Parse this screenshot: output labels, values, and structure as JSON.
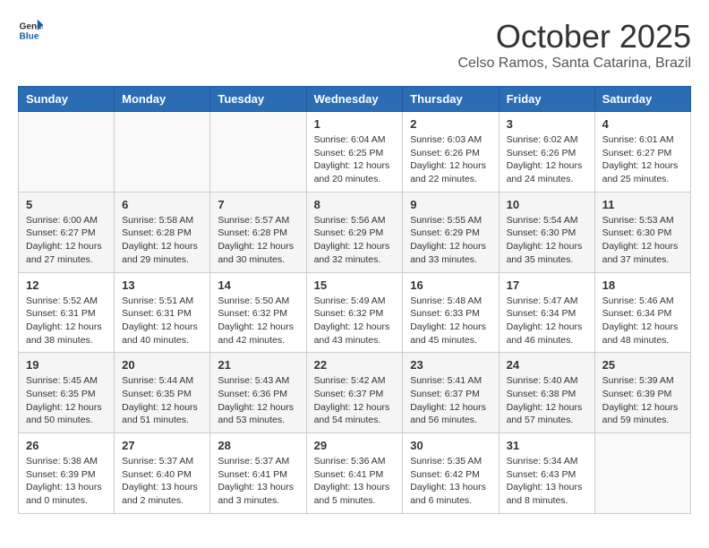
{
  "header": {
    "logo_general": "General",
    "logo_blue": "Blue",
    "month_title": "October 2025",
    "subtitle": "Celso Ramos, Santa Catarina, Brazil"
  },
  "weekdays": [
    "Sunday",
    "Monday",
    "Tuesday",
    "Wednesday",
    "Thursday",
    "Friday",
    "Saturday"
  ],
  "weeks": [
    [
      {
        "day": "",
        "info": ""
      },
      {
        "day": "",
        "info": ""
      },
      {
        "day": "",
        "info": ""
      },
      {
        "day": "1",
        "info": "Sunrise: 6:04 AM\nSunset: 6:25 PM\nDaylight: 12 hours\nand 20 minutes."
      },
      {
        "day": "2",
        "info": "Sunrise: 6:03 AM\nSunset: 6:26 PM\nDaylight: 12 hours\nand 22 minutes."
      },
      {
        "day": "3",
        "info": "Sunrise: 6:02 AM\nSunset: 6:26 PM\nDaylight: 12 hours\nand 24 minutes."
      },
      {
        "day": "4",
        "info": "Sunrise: 6:01 AM\nSunset: 6:27 PM\nDaylight: 12 hours\nand 25 minutes."
      }
    ],
    [
      {
        "day": "5",
        "info": "Sunrise: 6:00 AM\nSunset: 6:27 PM\nDaylight: 12 hours\nand 27 minutes."
      },
      {
        "day": "6",
        "info": "Sunrise: 5:58 AM\nSunset: 6:28 PM\nDaylight: 12 hours\nand 29 minutes."
      },
      {
        "day": "7",
        "info": "Sunrise: 5:57 AM\nSunset: 6:28 PM\nDaylight: 12 hours\nand 30 minutes."
      },
      {
        "day": "8",
        "info": "Sunrise: 5:56 AM\nSunset: 6:29 PM\nDaylight: 12 hours\nand 32 minutes."
      },
      {
        "day": "9",
        "info": "Sunrise: 5:55 AM\nSunset: 6:29 PM\nDaylight: 12 hours\nand 33 minutes."
      },
      {
        "day": "10",
        "info": "Sunrise: 5:54 AM\nSunset: 6:30 PM\nDaylight: 12 hours\nand 35 minutes."
      },
      {
        "day": "11",
        "info": "Sunrise: 5:53 AM\nSunset: 6:30 PM\nDaylight: 12 hours\nand 37 minutes."
      }
    ],
    [
      {
        "day": "12",
        "info": "Sunrise: 5:52 AM\nSunset: 6:31 PM\nDaylight: 12 hours\nand 38 minutes."
      },
      {
        "day": "13",
        "info": "Sunrise: 5:51 AM\nSunset: 6:31 PM\nDaylight: 12 hours\nand 40 minutes."
      },
      {
        "day": "14",
        "info": "Sunrise: 5:50 AM\nSunset: 6:32 PM\nDaylight: 12 hours\nand 42 minutes."
      },
      {
        "day": "15",
        "info": "Sunrise: 5:49 AM\nSunset: 6:32 PM\nDaylight: 12 hours\nand 43 minutes."
      },
      {
        "day": "16",
        "info": "Sunrise: 5:48 AM\nSunset: 6:33 PM\nDaylight: 12 hours\nand 45 minutes."
      },
      {
        "day": "17",
        "info": "Sunrise: 5:47 AM\nSunset: 6:34 PM\nDaylight: 12 hours\nand 46 minutes."
      },
      {
        "day": "18",
        "info": "Sunrise: 5:46 AM\nSunset: 6:34 PM\nDaylight: 12 hours\nand 48 minutes."
      }
    ],
    [
      {
        "day": "19",
        "info": "Sunrise: 5:45 AM\nSunset: 6:35 PM\nDaylight: 12 hours\nand 50 minutes."
      },
      {
        "day": "20",
        "info": "Sunrise: 5:44 AM\nSunset: 6:35 PM\nDaylight: 12 hours\nand 51 minutes."
      },
      {
        "day": "21",
        "info": "Sunrise: 5:43 AM\nSunset: 6:36 PM\nDaylight: 12 hours\nand 53 minutes."
      },
      {
        "day": "22",
        "info": "Sunrise: 5:42 AM\nSunset: 6:37 PM\nDaylight: 12 hours\nand 54 minutes."
      },
      {
        "day": "23",
        "info": "Sunrise: 5:41 AM\nSunset: 6:37 PM\nDaylight: 12 hours\nand 56 minutes."
      },
      {
        "day": "24",
        "info": "Sunrise: 5:40 AM\nSunset: 6:38 PM\nDaylight: 12 hours\nand 57 minutes."
      },
      {
        "day": "25",
        "info": "Sunrise: 5:39 AM\nSunset: 6:39 PM\nDaylight: 12 hours\nand 59 minutes."
      }
    ],
    [
      {
        "day": "26",
        "info": "Sunrise: 5:38 AM\nSunset: 6:39 PM\nDaylight: 13 hours\nand 0 minutes."
      },
      {
        "day": "27",
        "info": "Sunrise: 5:37 AM\nSunset: 6:40 PM\nDaylight: 13 hours\nand 2 minutes."
      },
      {
        "day": "28",
        "info": "Sunrise: 5:37 AM\nSunset: 6:41 PM\nDaylight: 13 hours\nand 3 minutes."
      },
      {
        "day": "29",
        "info": "Sunrise: 5:36 AM\nSunset: 6:41 PM\nDaylight: 13 hours\nand 5 minutes."
      },
      {
        "day": "30",
        "info": "Sunrise: 5:35 AM\nSunset: 6:42 PM\nDaylight: 13 hours\nand 6 minutes."
      },
      {
        "day": "31",
        "info": "Sunrise: 5:34 AM\nSunset: 6:43 PM\nDaylight: 13 hours\nand 8 minutes."
      },
      {
        "day": "",
        "info": ""
      }
    ]
  ]
}
